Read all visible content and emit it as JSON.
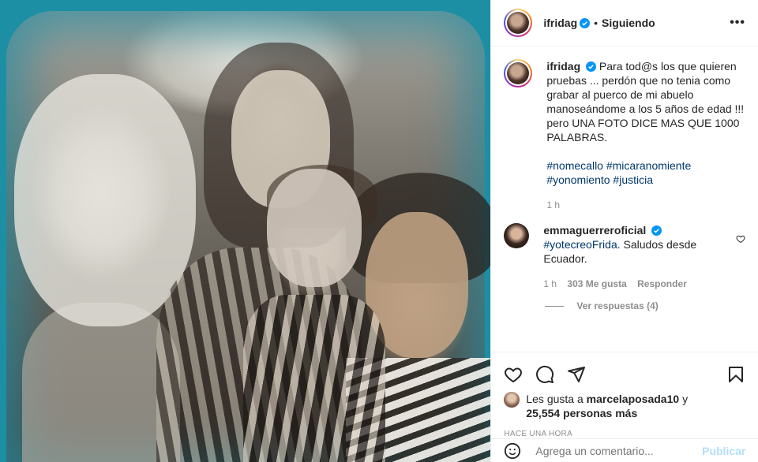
{
  "post": {
    "author": "ifridag",
    "follow_status": "Siguiendo",
    "more": "•••",
    "caption": "Para tod@s los que quieren pruebas ... perdón que no tenia como grabar al puerco de mi abuelo manoseándome a los 5 años de edad !!! pero UNA FOTO DICE MAS QUE 1000 PALABRAS.",
    "hashtags_line1": [
      "#nomecallo",
      "#micaranomiente"
    ],
    "hashtags_line2": [
      "#yonomiento",
      "#justicia"
    ],
    "caption_time": "1 h",
    "photo_alt": "Vintage family photograph"
  },
  "comments": [
    {
      "user": "emmaguerreroficial",
      "tag": "#yotecreoFrida",
      "text": ". Saludos desde Ecuador.",
      "time": "1 h",
      "likes": "303 Me gusta",
      "reply": "Responder",
      "view_replies": "Ver respuestas (4)"
    }
  ],
  "likes": {
    "prefix": "Les gusta a",
    "user": "marcelaposada10",
    "mid": "y",
    "count": "25,554 personas más"
  },
  "timestamp": "HACE UNA HORA",
  "add_comment": {
    "placeholder": "Agrega un comentario...",
    "publish": "Publicar"
  },
  "colors": {
    "verified": "#0095f6",
    "hashtag": "#00376b",
    "muted": "#8e8e8e",
    "publish_disabled": "#b2dffc"
  }
}
